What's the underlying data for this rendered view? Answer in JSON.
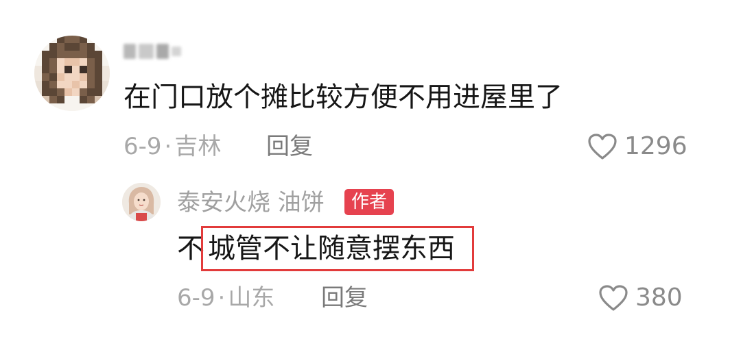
{
  "comment": {
    "avatar": {
      "icon": "user-avatar-pixelated-icon"
    },
    "text": "在门口放个摊比较方便不用进屋里了",
    "date": "6-9",
    "separator": "·",
    "location": "吉林",
    "reply_label": "回复",
    "likes": "1296"
  },
  "reply": {
    "avatar": {
      "icon": "author-avatar-icon"
    },
    "author_name": "泰安火烧 油饼",
    "author_badge": "作者",
    "text_prefix": "不",
    "text_highlighted": "城管不让随意摆东西",
    "date": "6-9",
    "separator": "·",
    "location": "山东",
    "reply_label": "回复",
    "likes": "380"
  },
  "colors": {
    "badge_bg": "#e6424f",
    "highlight_border": "#e23b3b",
    "text": "#161616",
    "meta": "#a8a8a8"
  }
}
